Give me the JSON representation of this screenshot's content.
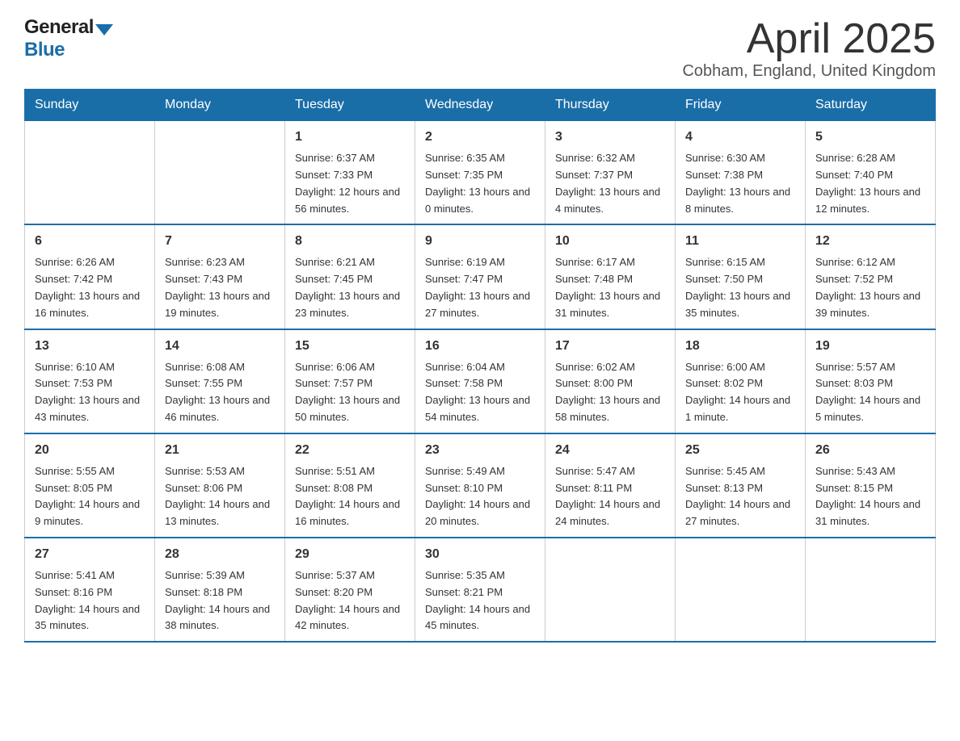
{
  "header": {
    "logo_general": "General",
    "logo_blue": "Blue",
    "title": "April 2025",
    "subtitle": "Cobham, England, United Kingdom"
  },
  "days_of_week": [
    "Sunday",
    "Monday",
    "Tuesday",
    "Wednesday",
    "Thursday",
    "Friday",
    "Saturday"
  ],
  "weeks": [
    [
      {
        "day": "",
        "sunrise": "",
        "sunset": "",
        "daylight": ""
      },
      {
        "day": "",
        "sunrise": "",
        "sunset": "",
        "daylight": ""
      },
      {
        "day": "1",
        "sunrise": "Sunrise: 6:37 AM",
        "sunset": "Sunset: 7:33 PM",
        "daylight": "Daylight: 12 hours and 56 minutes."
      },
      {
        "day": "2",
        "sunrise": "Sunrise: 6:35 AM",
        "sunset": "Sunset: 7:35 PM",
        "daylight": "Daylight: 13 hours and 0 minutes."
      },
      {
        "day": "3",
        "sunrise": "Sunrise: 6:32 AM",
        "sunset": "Sunset: 7:37 PM",
        "daylight": "Daylight: 13 hours and 4 minutes."
      },
      {
        "day": "4",
        "sunrise": "Sunrise: 6:30 AM",
        "sunset": "Sunset: 7:38 PM",
        "daylight": "Daylight: 13 hours and 8 minutes."
      },
      {
        "day": "5",
        "sunrise": "Sunrise: 6:28 AM",
        "sunset": "Sunset: 7:40 PM",
        "daylight": "Daylight: 13 hours and 12 minutes."
      }
    ],
    [
      {
        "day": "6",
        "sunrise": "Sunrise: 6:26 AM",
        "sunset": "Sunset: 7:42 PM",
        "daylight": "Daylight: 13 hours and 16 minutes."
      },
      {
        "day": "7",
        "sunrise": "Sunrise: 6:23 AM",
        "sunset": "Sunset: 7:43 PM",
        "daylight": "Daylight: 13 hours and 19 minutes."
      },
      {
        "day": "8",
        "sunrise": "Sunrise: 6:21 AM",
        "sunset": "Sunset: 7:45 PM",
        "daylight": "Daylight: 13 hours and 23 minutes."
      },
      {
        "day": "9",
        "sunrise": "Sunrise: 6:19 AM",
        "sunset": "Sunset: 7:47 PM",
        "daylight": "Daylight: 13 hours and 27 minutes."
      },
      {
        "day": "10",
        "sunrise": "Sunrise: 6:17 AM",
        "sunset": "Sunset: 7:48 PM",
        "daylight": "Daylight: 13 hours and 31 minutes."
      },
      {
        "day": "11",
        "sunrise": "Sunrise: 6:15 AM",
        "sunset": "Sunset: 7:50 PM",
        "daylight": "Daylight: 13 hours and 35 minutes."
      },
      {
        "day": "12",
        "sunrise": "Sunrise: 6:12 AM",
        "sunset": "Sunset: 7:52 PM",
        "daylight": "Daylight: 13 hours and 39 minutes."
      }
    ],
    [
      {
        "day": "13",
        "sunrise": "Sunrise: 6:10 AM",
        "sunset": "Sunset: 7:53 PM",
        "daylight": "Daylight: 13 hours and 43 minutes."
      },
      {
        "day": "14",
        "sunrise": "Sunrise: 6:08 AM",
        "sunset": "Sunset: 7:55 PM",
        "daylight": "Daylight: 13 hours and 46 minutes."
      },
      {
        "day": "15",
        "sunrise": "Sunrise: 6:06 AM",
        "sunset": "Sunset: 7:57 PM",
        "daylight": "Daylight: 13 hours and 50 minutes."
      },
      {
        "day": "16",
        "sunrise": "Sunrise: 6:04 AM",
        "sunset": "Sunset: 7:58 PM",
        "daylight": "Daylight: 13 hours and 54 minutes."
      },
      {
        "day": "17",
        "sunrise": "Sunrise: 6:02 AM",
        "sunset": "Sunset: 8:00 PM",
        "daylight": "Daylight: 13 hours and 58 minutes."
      },
      {
        "day": "18",
        "sunrise": "Sunrise: 6:00 AM",
        "sunset": "Sunset: 8:02 PM",
        "daylight": "Daylight: 14 hours and 1 minute."
      },
      {
        "day": "19",
        "sunrise": "Sunrise: 5:57 AM",
        "sunset": "Sunset: 8:03 PM",
        "daylight": "Daylight: 14 hours and 5 minutes."
      }
    ],
    [
      {
        "day": "20",
        "sunrise": "Sunrise: 5:55 AM",
        "sunset": "Sunset: 8:05 PM",
        "daylight": "Daylight: 14 hours and 9 minutes."
      },
      {
        "day": "21",
        "sunrise": "Sunrise: 5:53 AM",
        "sunset": "Sunset: 8:06 PM",
        "daylight": "Daylight: 14 hours and 13 minutes."
      },
      {
        "day": "22",
        "sunrise": "Sunrise: 5:51 AM",
        "sunset": "Sunset: 8:08 PM",
        "daylight": "Daylight: 14 hours and 16 minutes."
      },
      {
        "day": "23",
        "sunrise": "Sunrise: 5:49 AM",
        "sunset": "Sunset: 8:10 PM",
        "daylight": "Daylight: 14 hours and 20 minutes."
      },
      {
        "day": "24",
        "sunrise": "Sunrise: 5:47 AM",
        "sunset": "Sunset: 8:11 PM",
        "daylight": "Daylight: 14 hours and 24 minutes."
      },
      {
        "day": "25",
        "sunrise": "Sunrise: 5:45 AM",
        "sunset": "Sunset: 8:13 PM",
        "daylight": "Daylight: 14 hours and 27 minutes."
      },
      {
        "day": "26",
        "sunrise": "Sunrise: 5:43 AM",
        "sunset": "Sunset: 8:15 PM",
        "daylight": "Daylight: 14 hours and 31 minutes."
      }
    ],
    [
      {
        "day": "27",
        "sunrise": "Sunrise: 5:41 AM",
        "sunset": "Sunset: 8:16 PM",
        "daylight": "Daylight: 14 hours and 35 minutes."
      },
      {
        "day": "28",
        "sunrise": "Sunrise: 5:39 AM",
        "sunset": "Sunset: 8:18 PM",
        "daylight": "Daylight: 14 hours and 38 minutes."
      },
      {
        "day": "29",
        "sunrise": "Sunrise: 5:37 AM",
        "sunset": "Sunset: 8:20 PM",
        "daylight": "Daylight: 14 hours and 42 minutes."
      },
      {
        "day": "30",
        "sunrise": "Sunrise: 5:35 AM",
        "sunset": "Sunset: 8:21 PM",
        "daylight": "Daylight: 14 hours and 45 minutes."
      },
      {
        "day": "",
        "sunrise": "",
        "sunset": "",
        "daylight": ""
      },
      {
        "day": "",
        "sunrise": "",
        "sunset": "",
        "daylight": ""
      },
      {
        "day": "",
        "sunrise": "",
        "sunset": "",
        "daylight": ""
      }
    ]
  ]
}
